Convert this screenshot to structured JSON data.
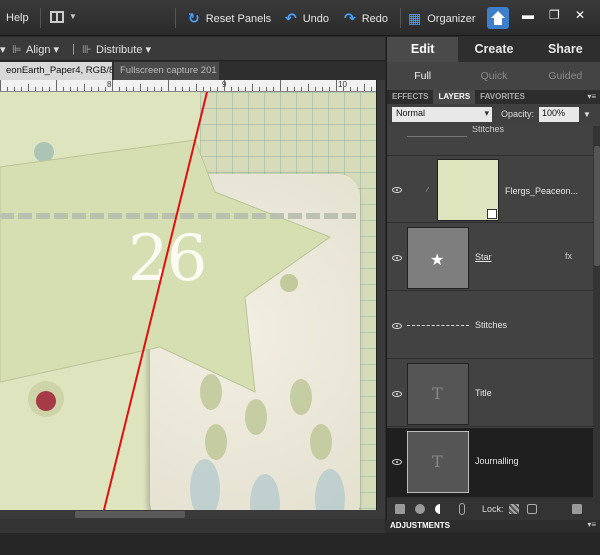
{
  "menubar": {
    "help": "Help",
    "reset_panels": "Reset Panels",
    "undo": "Undo",
    "redo": "Redo",
    "organizer": "Organizer",
    "icons": [
      "layout-icon",
      "reset-panels-icon",
      "undo-icon",
      "redo-icon",
      "organizer-icon",
      "home-icon",
      "minimize-icon",
      "restore-icon",
      "close-icon"
    ]
  },
  "options_bar": {
    "align": "Align",
    "distribute": "Distribute"
  },
  "document_tabs": [
    {
      "label": "eonEarth_Paper4, RGB/8) *",
      "active": true
    },
    {
      "label": "Fullscreen capture 201",
      "active": false
    }
  ],
  "ruler": {
    "labels": [
      "8",
      "9",
      "10"
    ]
  },
  "canvas": {
    "number_text": "26"
  },
  "panel": {
    "mode_tabs": [
      {
        "label": "Edit",
        "active": true
      },
      {
        "label": "Create",
        "active": false
      },
      {
        "label": "Share",
        "active": false
      }
    ],
    "sub_tabs": [
      {
        "label": "Full",
        "active": true
      },
      {
        "label": "Quick",
        "active": false
      },
      {
        "label": "Guided",
        "active": false
      }
    ],
    "panel_tabs": [
      {
        "label": "EFFECTS",
        "active": false
      },
      {
        "label": "LAYERS",
        "active": true
      },
      {
        "label": "FAVORITES",
        "active": false
      }
    ],
    "blend_mode": "Normal",
    "opacity_label": "Opacity:",
    "opacity_value": "100%",
    "layers": [
      {
        "name": "Stitches",
        "type": "partial"
      },
      {
        "name": "Flergs_Peaceon...",
        "type": "paper"
      },
      {
        "name": "Star",
        "type": "shape"
      },
      {
        "name": "Stitches",
        "type": "line"
      },
      {
        "name": "Title",
        "type": "text"
      },
      {
        "name": "Journalling",
        "type": "text",
        "selected": true
      }
    ],
    "lock_label": "Lock:",
    "adjustments": "ADJUSTMENTS"
  },
  "colors": {
    "accent": "#4aa3ff",
    "paper": "#dde4be",
    "guide_line": "#e01010"
  }
}
